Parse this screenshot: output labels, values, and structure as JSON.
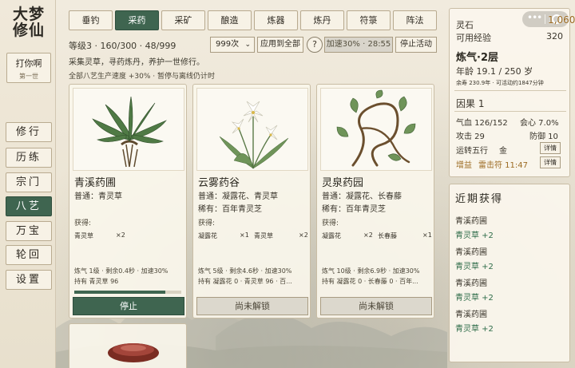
{
  "logo": {
    "line1": "大梦",
    "line2": "修仙"
  },
  "player": {
    "name": "打你啊",
    "generation": "第一世"
  },
  "nav": [
    {
      "label": "修行",
      "active": false
    },
    {
      "label": "历练",
      "active": false
    },
    {
      "label": "宗门",
      "active": false
    },
    {
      "label": "八艺",
      "active": true
    },
    {
      "label": "万宝",
      "active": false
    },
    {
      "label": "轮回",
      "active": false
    },
    {
      "label": "设置",
      "active": false
    }
  ],
  "tabs": [
    {
      "label": "垂钓",
      "active": false
    },
    {
      "label": "采药",
      "active": true
    },
    {
      "label": "采矿",
      "active": false
    },
    {
      "label": "酿造",
      "active": false
    },
    {
      "label": "炼器",
      "active": false
    },
    {
      "label": "炼丹",
      "active": false
    },
    {
      "label": "符箓",
      "active": false
    },
    {
      "label": "阵法",
      "active": false
    }
  ],
  "skill": {
    "stats": "等级3 · 160/300 · 48/999",
    "quantity": "999次",
    "apply_all": "应用到全部",
    "help": "?",
    "accel": "加速30% · 28:55",
    "stop_all": "停止活动",
    "description": "采集灵草，寻药炼丹，养护一世修行。",
    "bonus": "全部八艺生产速度 +30% · 暂停与离线仍计时"
  },
  "cards": [
    {
      "name": "青溪药圃",
      "common": "普通：青灵草",
      "rare": "",
      "yield_label": "获得:",
      "drops": [
        {
          "item": "青灵草",
          "count": "×2"
        }
      ],
      "info1": "炼气 1级 · 剩余0.4秒 · 加速30%",
      "info2": "持有 青灵草 96",
      "progress": 0.85,
      "action": "停止",
      "running": true
    },
    {
      "name": "云雾药谷",
      "common": "普通：凝露花、青灵草",
      "rare": "稀有：百年青灵芝",
      "yield_label": "获得:",
      "drops": [
        {
          "item": "凝露花",
          "count": "×1"
        },
        {
          "item": "青灵草",
          "count": "×2"
        }
      ],
      "info1": "炼气 5级 · 剩余4.6秒 · 加速30%",
      "info2": "持有 凝露花 0 · 青灵草 96 · 百...",
      "progress": 0,
      "action": "尚未解锁",
      "running": false
    },
    {
      "name": "灵泉药园",
      "common": "普通：凝露花、长春藤",
      "rare": "稀有：百年青灵芝",
      "yield_label": "获得:",
      "drops": [
        {
          "item": "凝露花",
          "count": "×2"
        },
        {
          "item": "长春藤",
          "count": "×1"
        }
      ],
      "info1": "炼气 10级 · 剩余6.9秒 · 加速30%",
      "info2": "持有 凝露花 0 · 长春藤 0 · 百年...",
      "progress": 0,
      "action": "尚未解锁",
      "running": false
    }
  ],
  "status": {
    "stone_label": "灵石",
    "stone_value": "1,060",
    "exp_label": "可用经验",
    "exp_value": "320",
    "realm": "炼气·2层",
    "age": "年龄 19.1 / 250 岁",
    "lifespan": "余寿 230.9年 · 可活动约1847分钟",
    "karma": "因果 1",
    "hp": "气血 126/152",
    "crit": "会心 7.0%",
    "attack": "攻击 29",
    "defense": "防御 10",
    "luck_label": "运转五行",
    "luck_value": "金",
    "detail": "详情",
    "buff_label": "增益",
    "buff_value": "雷击符 11:47",
    "detail2": "详情"
  },
  "recent": {
    "title": "近期获得",
    "items": [
      {
        "source": "青溪药圃",
        "item": "青灵草 +2"
      },
      {
        "source": "青溪药圃",
        "item": "青灵草 +2"
      },
      {
        "source": "青溪药圃",
        "item": "青灵草 +2"
      },
      {
        "source": "青溪药圃",
        "item": "青灵草 +2"
      }
    ]
  },
  "colors": {
    "accent": "#3f6550",
    "gold": "#9c6b22",
    "gain": "#2f6d4a",
    "background": "#ece4d3"
  }
}
